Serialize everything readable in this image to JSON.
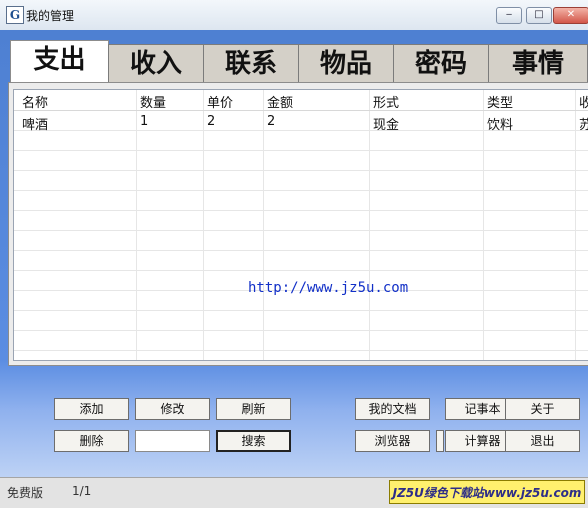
{
  "window": {
    "title": "我的管理",
    "app_icon_glyph": "G",
    "controls": [
      "‒",
      "□",
      "✕"
    ]
  },
  "tabs": [
    "支出",
    "收入",
    "联系",
    "物品",
    "密码",
    "事情"
  ],
  "active_tab": "支出",
  "table": {
    "columns": [
      "名称",
      "数量",
      "单价",
      "金额",
      "形式",
      "类型",
      "收"
    ],
    "rows": [
      [
        "啤酒",
        "1",
        "2",
        "2",
        "现金",
        "饮料",
        "苏"
      ]
    ]
  },
  "watermark_url": "http://www.jz5u.com",
  "buttons": {
    "add": "添加",
    "modify": "修改",
    "refresh": "刷新",
    "my_docs": "我的文档",
    "notepad": "记事本",
    "about": "关于",
    "delete": "删除",
    "search": "搜索",
    "browser": "浏览器",
    "calculator": "计算器",
    "exit": "退出"
  },
  "search_input_value": "",
  "status": {
    "edition": "免费版",
    "page": "1/1",
    "badge": "JZ5U绿色下载站www.jz5u.com"
  }
}
